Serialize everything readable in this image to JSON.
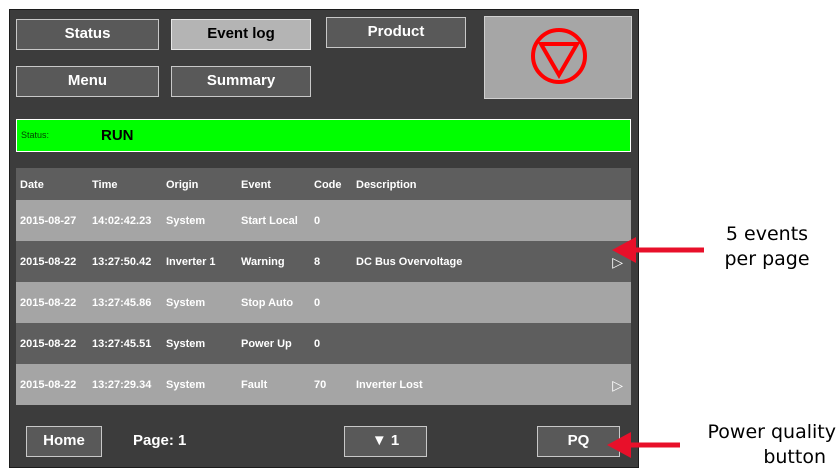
{
  "nav": {
    "status": "Status",
    "event_log": "Event log",
    "product": "Product",
    "menu": "Menu",
    "summary": "Summary"
  },
  "status_bar": {
    "label": "Status:",
    "value": "RUN",
    "color": "#00ff00"
  },
  "table": {
    "headers": [
      "Date",
      "Time",
      "Origin",
      "Event",
      "Code",
      "Description"
    ],
    "rows": [
      [
        "2015-08-27",
        "14:02:42.23",
        "System",
        "Start Local",
        "0",
        ""
      ],
      [
        "2015-08-22",
        "13:27:50.42",
        "Inverter 1",
        "Warning",
        "8",
        "DC Bus Overvoltage"
      ],
      [
        "2015-08-22",
        "13:27:45.86",
        "System",
        "Stop Auto",
        "0",
        ""
      ],
      [
        "2015-08-22",
        "13:27:45.51",
        "System",
        "Power Up",
        "0",
        ""
      ],
      [
        "2015-08-22",
        "13:27:29.34",
        "System",
        "Fault",
        "70",
        "Inverter Lost"
      ]
    ]
  },
  "footer": {
    "home": "Home",
    "page": "Page: 1",
    "page_select": "▼ 1",
    "pq": "PQ"
  },
  "annotations": {
    "events_line1": "5 events",
    "events_line2": "per page",
    "pq_line1": "Power quality",
    "pq_line2": "button"
  },
  "icons": {
    "stop": "stop-circle-triangle-icon",
    "row_detail": "play-outline-icon",
    "arrow": "red-arrow"
  },
  "colors": {
    "stop_icon": "#ff0000",
    "annotation_arrow": "#e8102a",
    "panel": "#3c3c3c"
  }
}
